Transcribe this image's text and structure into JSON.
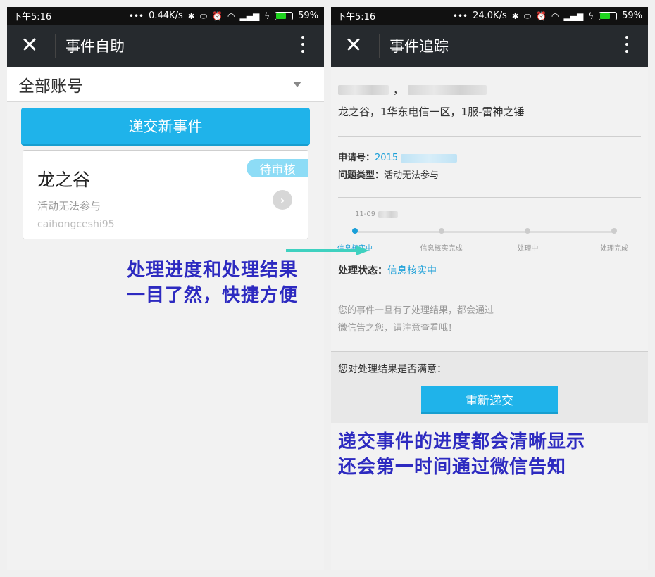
{
  "left": {
    "status_bar": {
      "time": "下午5:16",
      "speed": "0.44K/s",
      "battery": "59%"
    },
    "title_bar": {
      "title": "事件自助"
    },
    "account_select": {
      "value": "全部账号"
    },
    "submit_button": "递交新事件",
    "event_card": {
      "game": "龙之谷",
      "issue": "活动无法参与",
      "account": "caihongceshi95",
      "status": "待审核"
    }
  },
  "right": {
    "status_bar": {
      "time": "下午5:16",
      "speed": "24.0K/s",
      "battery": "59%"
    },
    "title_bar": {
      "title": "事件追踪"
    },
    "comma": "，",
    "server_line": "龙之谷，1华东电信一区，1服-雷神之锤",
    "request_no": {
      "label": "申请号：",
      "value": "2015"
    },
    "issue_type": {
      "label": "问题类型：",
      "value": "活动无法参与"
    },
    "progress": {
      "date": "11-09",
      "steps": [
        {
          "label": "信息核实中",
          "active": true
        },
        {
          "label": "信息核实完成",
          "active": false
        },
        {
          "label": "处理中",
          "active": false
        },
        {
          "label": "处理完成",
          "active": false
        }
      ]
    },
    "status": {
      "label": "处理状态：",
      "value": "信息核实中"
    },
    "notice_line1": "您的事件一旦有了处理结果，都会通过",
    "notice_line2": "微信告之您，请注意查看哦！",
    "satisfy_question": "您对处理结果是否满意：",
    "resubmit_button": "重新递交"
  },
  "overlay": {
    "left_line1": "处理进度和处理结果",
    "left_line2": "一目了然，快捷方便",
    "right_line1": "递交事件的进度都会清晰显示",
    "right_line2": "还会第一时间通过微信告知"
  },
  "colors": {
    "accent": "#1fb3ea",
    "overlay_text": "#2d2ac0",
    "arrow": "#3fd1c0",
    "titlebar": "#262a2e"
  }
}
